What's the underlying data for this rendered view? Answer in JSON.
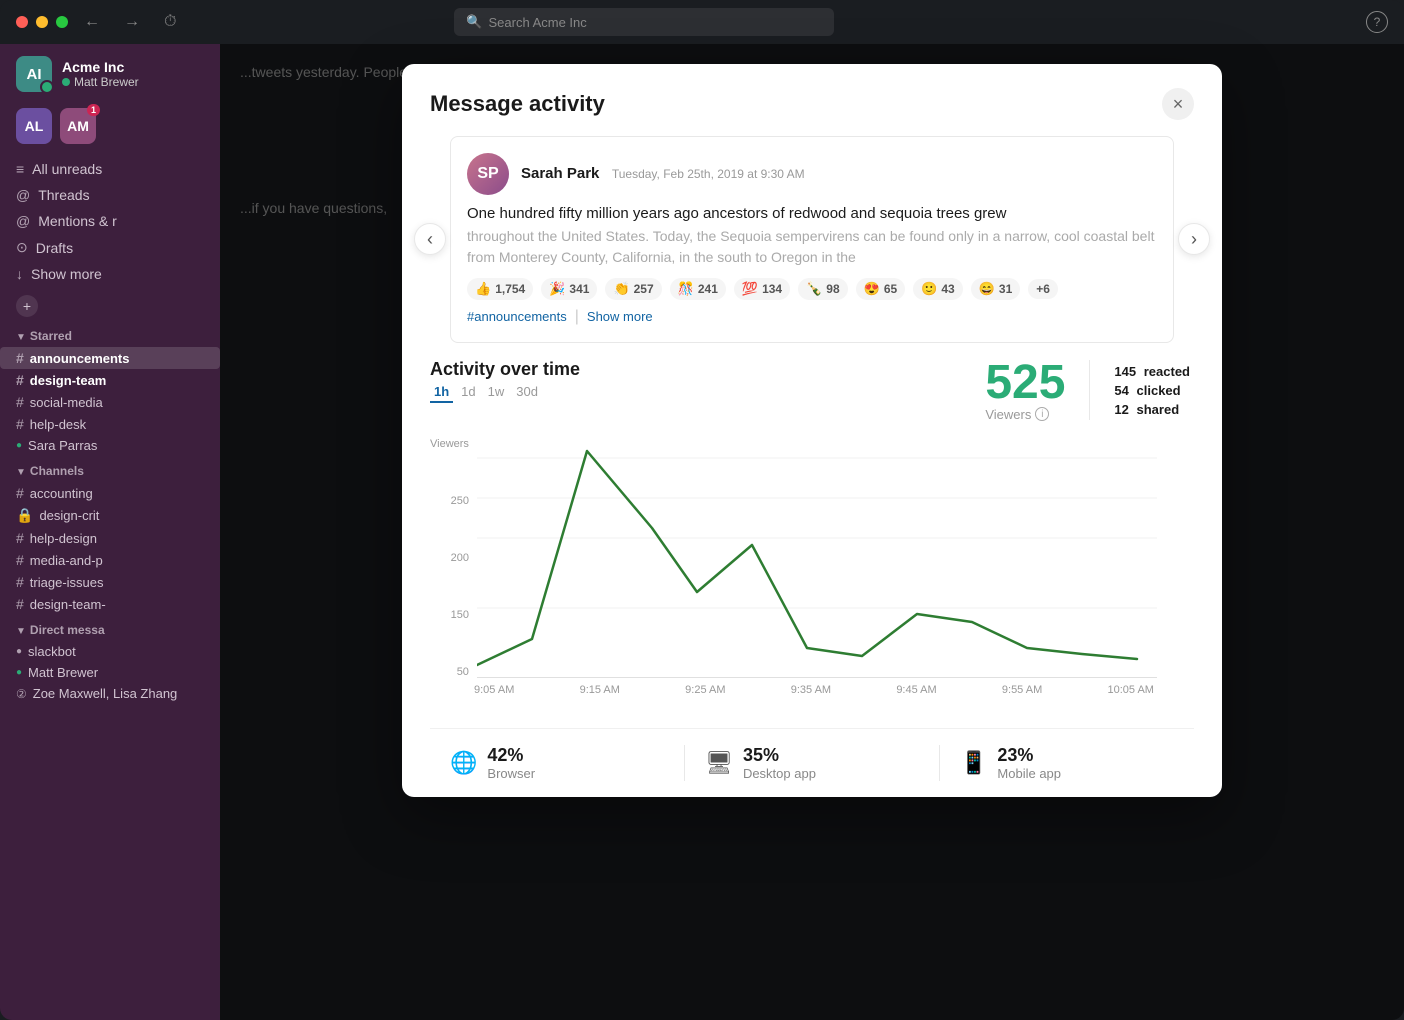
{
  "titlebar": {
    "search_placeholder": "Search Acme Inc"
  },
  "sidebar": {
    "workspace": "Acme Inc",
    "user": "Matt Brewer",
    "nav_items": [
      {
        "id": "all-unreads",
        "label": "All unreads",
        "icon": "≡",
        "badge": null
      },
      {
        "id": "threads",
        "label": "Threads",
        "icon": "@",
        "badge": null
      },
      {
        "id": "mentions",
        "label": "Mentions & r",
        "icon": "@",
        "badge": null
      },
      {
        "id": "drafts",
        "label": "Drafts",
        "icon": "⊙",
        "badge": null
      },
      {
        "id": "show-more",
        "label": "Show more",
        "icon": "↓",
        "badge": null
      }
    ],
    "starred_section": "Starred",
    "starred_channels": [
      {
        "id": "announcements",
        "label": "announcements",
        "prefix": "#",
        "active": true
      },
      {
        "id": "design-team",
        "label": "design-team",
        "prefix": "#",
        "bold": true
      },
      {
        "id": "social-media",
        "label": "social-media",
        "prefix": "#"
      },
      {
        "id": "help-desk",
        "label": "help-desk",
        "prefix": "#"
      },
      {
        "id": "sara-parras",
        "label": "Sara Parras",
        "prefix": "●",
        "is_dm": true
      }
    ],
    "channels_section": "Channels",
    "channels": [
      {
        "id": "accounting",
        "label": "accounting",
        "prefix": "#"
      },
      {
        "id": "design-crit",
        "label": "design-crit",
        "prefix": "🔒"
      },
      {
        "id": "help-design",
        "label": "help-design",
        "prefix": "#"
      },
      {
        "id": "media-and-pr",
        "label": "media-and-p",
        "prefix": "#"
      },
      {
        "id": "triage-issues",
        "label": "triage-issues",
        "prefix": "#"
      },
      {
        "id": "design-team-2",
        "label": "design-team-",
        "prefix": "#"
      }
    ],
    "dm_section": "Direct messa",
    "dms": [
      {
        "id": "slackbot",
        "label": "slackbot",
        "online": false
      },
      {
        "id": "matt-brewer",
        "label": "Matt Brewer",
        "online": true
      },
      {
        "id": "zoe-maxwell",
        "label": "Zoe Maxwell, Lisa Zhang",
        "online": false,
        "count": 2
      }
    ]
  },
  "modal": {
    "title": "Message activity",
    "close_label": "×",
    "message": {
      "sender": "Sarah Park",
      "timestamp": "Tuesday, Feb 25th, 2019 at 9:30 AM",
      "text_primary": "One hundred fifty million years ago ancestors of redwood and sequoia trees grew",
      "text_secondary": "throughout the United States. Today, the Sequoia sempervirens can be found only in a narrow, cool coastal belt from Monterey County, California, in the south to Oregon in the",
      "reactions": [
        {
          "emoji": "👍",
          "count": "1,754"
        },
        {
          "emoji": "🎉",
          "count": "341"
        },
        {
          "emoji": "👏",
          "count": "257"
        },
        {
          "emoji": "🎊",
          "count": "241"
        },
        {
          "emoji": "💯",
          "count": "134"
        },
        {
          "emoji": "🍾",
          "count": "98"
        },
        {
          "emoji": "😍",
          "count": "65"
        },
        {
          "emoji": "🙂",
          "count": "43"
        },
        {
          "emoji": "😄",
          "count": "31"
        },
        {
          "emoji": "+6",
          "count": ""
        }
      ],
      "channel_tag": "#announcements",
      "show_more_label": "Show more"
    },
    "activity": {
      "title": "Activity over time",
      "time_filters": [
        {
          "label": "1h",
          "active": true
        },
        {
          "label": "1d",
          "active": false
        },
        {
          "label": "1w",
          "active": false
        },
        {
          "label": "30d",
          "active": false
        }
      ],
      "viewers_count": "525",
      "viewers_label": "Viewers",
      "stats": {
        "reacted_count": "145",
        "reacted_label": "reacted",
        "clicked_count": "54",
        "clicked_label": "clicked",
        "shared_count": "12",
        "shared_label": "shared"
      },
      "chart": {
        "y_labels": [
          "250",
          "200",
          "150",
          "50"
        ],
        "x_labels": [
          "9:05 AM",
          "9:15 AM",
          "9:25 AM",
          "9:35 AM",
          "9:45 AM",
          "9:55 AM",
          "10:05 AM"
        ],
        "data_points": [
          {
            "time": "9:05 AM",
            "value": 15
          },
          {
            "time": "9:08 AM",
            "value": 45
          },
          {
            "time": "9:15 AM",
            "value": 265
          },
          {
            "time": "9:22 AM",
            "value": 175
          },
          {
            "time": "9:25 AM",
            "value": 100
          },
          {
            "time": "9:30 AM",
            "value": 155
          },
          {
            "time": "9:35 AM",
            "value": 35
          },
          {
            "time": "9:40 AM",
            "value": 25
          },
          {
            "time": "9:45 AM",
            "value": 75
          },
          {
            "time": "9:50 AM",
            "value": 65
          },
          {
            "time": "9:55 AM",
            "value": 35
          },
          {
            "time": "10:00 AM",
            "value": 28
          },
          {
            "time": "10:05 AM",
            "value": 22
          }
        ]
      },
      "platforms": [
        {
          "id": "browser",
          "icon": "🌐",
          "pct": "42%",
          "label": "Browser"
        },
        {
          "id": "desktop",
          "icon": "🖥",
          "pct": "35%",
          "label": "Desktop app"
        },
        {
          "id": "mobile",
          "icon": "📱",
          "pct": "23%",
          "label": "Mobile app"
        }
      ]
    }
  }
}
